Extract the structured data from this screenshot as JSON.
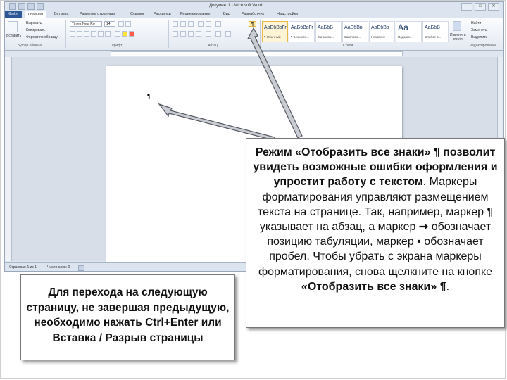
{
  "window": {
    "title": "Документ1 - Microsoft Word",
    "buttons": {
      "minimize": "–",
      "maximize": "□",
      "close": "✕"
    }
  },
  "tabs": [
    "Файл",
    "Главная",
    "Вставка",
    "Разметка страницы",
    "Ссылки",
    "Рассылки",
    "Рецензирование",
    "Вид",
    "Разработчик",
    "Надстройки"
  ],
  "ribbon": {
    "clipboard": {
      "paste": "Вставить",
      "cut": "Вырезать",
      "copy": "Копировать",
      "format_painter": "Формат по образцу",
      "label": "Буфер обмена"
    },
    "font": {
      "name": "Times New Ro",
      "size": "14",
      "label": "Шрифт"
    },
    "paragraph": {
      "label": "Абзац",
      "show_marks": "¶"
    },
    "styles": {
      "label": "Стили",
      "items": [
        {
          "sample": "АаБбВвГг",
          "name": "¶ Обычный"
        },
        {
          "sample": "АаБбВвГг",
          "name": "¶ Без инте..."
        },
        {
          "sample": "АаБбВ",
          "name": "Заголово..."
        },
        {
          "sample": "АаБбВв",
          "name": "Заголово..."
        },
        {
          "sample": "АаБбВв",
          "name": "Название"
        },
        {
          "sample": "Аа",
          "name": "Подзаго..."
        },
        {
          "sample": "АаБбВ",
          "name": "Слабое в..."
        }
      ],
      "change_styles": "Изменить стили"
    },
    "editing": {
      "find": "Найти",
      "replace": "Заменить",
      "select": "Выделить",
      "label": "Редактирование"
    }
  },
  "document": {
    "cursor_mark": "¶"
  },
  "status": {
    "page": "Страница: 1 из 1",
    "words": "Число слов: 0"
  },
  "callouts": {
    "right": {
      "bold_text": "Режим «Отобразить все знаки» ¶ позволит увидеть возможные ошибки оформления и упростит работу с текстом",
      "text_1": ". Маркеры форматирования управляют размещением текста на странице. Так, например, маркер ¶ указывает на абзац, а маркер",
      "tab_marker": "➞",
      "text_2": "обозначает позицию табуляции, маркер",
      "space_marker": "•",
      "text_3": "обозначает пробел. Чтобы убрать с экрана маркеры форматирования, снова щелкните на кнопке",
      "bold_end": "«Отобразить все знаки» ¶",
      "text_end": "."
    },
    "left": {
      "text": "Для перехода на следующую страницу, не завершая предыдущую, необходимо нажать Ctrl+Enter или Вставка / Разрыв страницы"
    }
  }
}
